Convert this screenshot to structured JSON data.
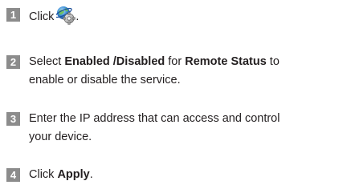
{
  "steps": [
    {
      "number": "1",
      "prefix": "Click",
      "icon": "remote-settings-globe-gear-icon",
      "suffix": "."
    },
    {
      "number": "2",
      "line1_a": "Select ",
      "line1_b": "Enabled /Disabled",
      "line1_c": " for ",
      "line1_d": "Remote Status",
      "line1_e": " to",
      "line2": "enable or disable the service."
    },
    {
      "number": "3",
      "line1": "Enter the IP address that can access and control",
      "line2": "your device."
    },
    {
      "number": "4",
      "prefix": "Click ",
      "bold": "Apply",
      "suffix": "."
    }
  ]
}
